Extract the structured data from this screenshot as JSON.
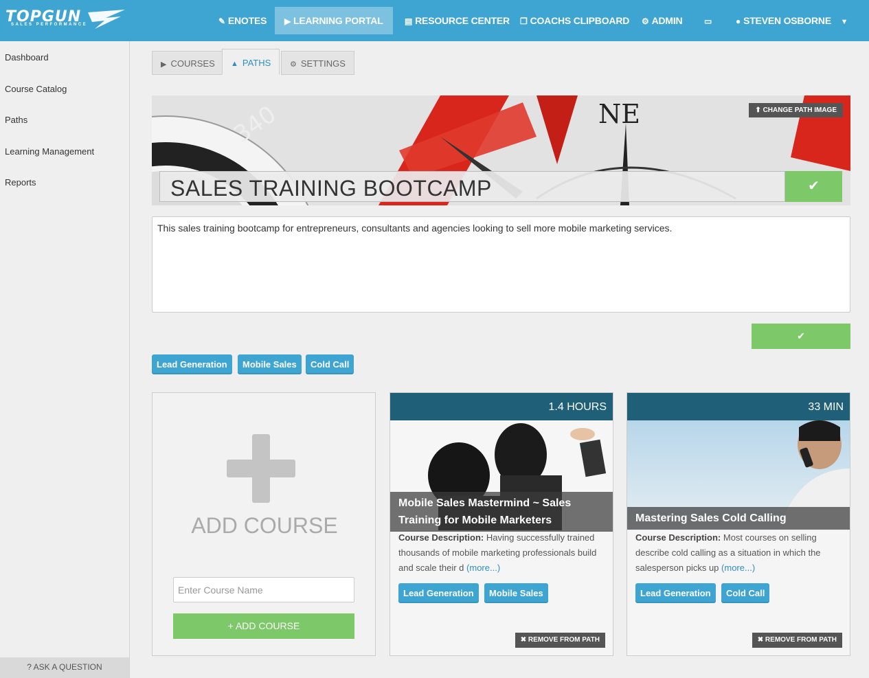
{
  "brand": {
    "name": "TOPGUN",
    "tagline": "SALES PERFORMANCE"
  },
  "nav": {
    "enotes": "ENOTES",
    "learning_portal": "LEARNING PORTAL",
    "resource_center": "RESOURCE CENTER",
    "coachs_clipboard": "COACHS CLIPBOARD",
    "admin": "ADMIN",
    "user": "STEVEN OSBORNE"
  },
  "sidebar": {
    "items": [
      "Dashboard",
      "Course Catalog",
      "Paths",
      "Learning Management",
      "Reports"
    ],
    "ask": "? ASK A QUESTION"
  },
  "tabs": {
    "courses": "COURSES",
    "paths": "PATHS",
    "settings": "SETTINGS"
  },
  "hero": {
    "change_image": "CHANGE PATH IMAGE",
    "title": "SALES TRAINING BOOTCAMP",
    "compass_ne": "NE",
    "compass_340": "340"
  },
  "description": "This sales training bootcamp for entrepreneurs, consultants and agencies looking to sell more mobile marketing services.",
  "path_tags": [
    "Lead Generation",
    "Mobile Sales",
    "Cold Call"
  ],
  "add_course": {
    "label": "ADD COURSE",
    "placeholder": "Enter Course Name",
    "button": "+ ADD COURSE"
  },
  "courses": [
    {
      "duration": "1.4 HOURS",
      "title_line1": "Mobile Sales Mastermind ~ Sales",
      "title_line2": "Training for Mobile Marketers",
      "desc_label": "Course Description:",
      "desc_text": "Having successfully trained thousands of mobile marketing professionals build and scale their d",
      "more": "(more...)",
      "tags": [
        "Lead Generation",
        "Mobile Sales"
      ],
      "remove": "REMOVE FROM PATH"
    },
    {
      "duration": "33 MIN",
      "title_line1": "Mastering Sales Cold Calling",
      "desc_label": "Course Description:",
      "desc_text": "Most courses on selling describe cold calling as a situation in which the salesperson picks up",
      "more": "(more...)",
      "tags": [
        "Lead Generation",
        "Cold Call"
      ],
      "remove": "REMOVE FROM PATH"
    }
  ],
  "colors": {
    "nav_blue": "#3ea5d2",
    "dark_teal": "#1f5f78",
    "green": "#7dc96a",
    "tag_blue": "#3ea5d2"
  }
}
